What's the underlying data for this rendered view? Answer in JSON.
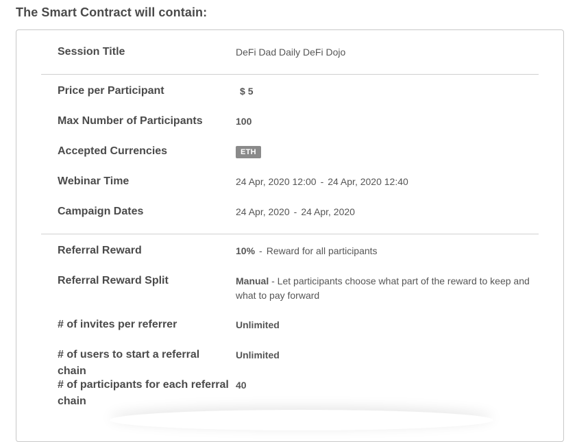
{
  "heading": "The Smart Contract will contain:",
  "rows": {
    "session_title": {
      "label": "Session Title",
      "value": "DeFi Dad Daily DeFi Dojo"
    },
    "price": {
      "label": "Price per Participant",
      "currency": "$",
      "amount": "5"
    },
    "max_participants": {
      "label": "Max Number of Participants",
      "value": "100"
    },
    "currencies": {
      "label": "Accepted Currencies",
      "badge": "ETH"
    },
    "webinar_time": {
      "label": "Webinar Time",
      "start": "24 Apr, 2020 12:00",
      "sep": "-",
      "end": "24 Apr, 2020 12:40"
    },
    "campaign_dates": {
      "label": "Campaign Dates",
      "start": "24 Apr, 2020",
      "sep": "-",
      "end": "24 Apr, 2020"
    },
    "referral_reward": {
      "label": "Referral Reward",
      "percent": "10%",
      "sep": "-",
      "desc": "Reward for all participants"
    },
    "referral_split": {
      "label": "Referral Reward Split",
      "mode": "Manual",
      "desc": " - Let participants choose what part of the reward to keep and what to pay forward"
    },
    "invites": {
      "label": "# of invites per referrer",
      "value": "Unlimited"
    },
    "chain_users": {
      "label": "# of users to start a referral chain",
      "value": "Unlimited"
    },
    "chain_participants": {
      "label": "# of participants for each referral chain",
      "value": "40"
    }
  }
}
